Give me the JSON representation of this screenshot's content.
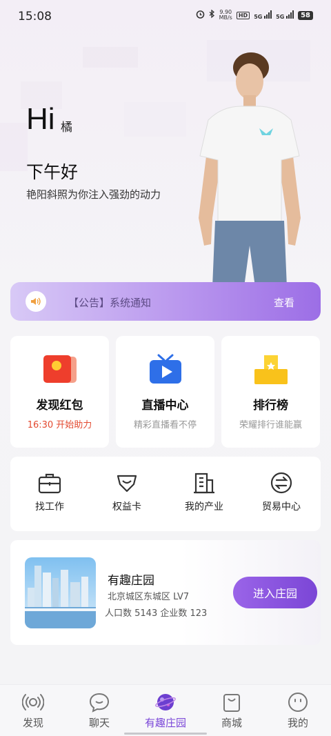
{
  "status_bar": {
    "time": "15:08",
    "network_speed": "9.90\nMB/s",
    "hd_label": "HD",
    "signal1": "5G",
    "signal2": "5G",
    "battery": "58"
  },
  "hero": {
    "hi": "Hi",
    "name": "橘",
    "greeting": "下午好",
    "subtitle": "艳阳斜照为你注入强劲的动力"
  },
  "notice": {
    "text": "【公告】系统通知",
    "action": "查看"
  },
  "features": [
    {
      "title": "发现红包",
      "subtitle": "16:30 开始助力",
      "icon": "red-envelope-icon",
      "subtitle_color": "#e3492f"
    },
    {
      "title": "直播中心",
      "subtitle": "精彩直播看不停",
      "icon": "live-tv-icon"
    },
    {
      "title": "排行榜",
      "subtitle": "荣耀排行谁能赢",
      "icon": "podium-icon"
    }
  ],
  "tools": [
    {
      "label": "找工作",
      "icon": "briefcase-icon"
    },
    {
      "label": "权益卡",
      "icon": "benefit-card-icon"
    },
    {
      "label": "我的产业",
      "icon": "building-icon"
    },
    {
      "label": "贸易中心",
      "icon": "exchange-icon"
    }
  ],
  "manor": {
    "title": "有趣庄园",
    "location": "北京城区东城区 LV7",
    "stats": "人口数 5143 企业数 123",
    "button": "进入庄园"
  },
  "bottom_nav": [
    {
      "label": "发现",
      "icon": "broadcast-icon",
      "active": false
    },
    {
      "label": "聊天",
      "icon": "chat-icon",
      "active": false
    },
    {
      "label": "有趣庄园",
      "icon": "planet-icon",
      "active": true
    },
    {
      "label": "商城",
      "icon": "shopping-bag-icon",
      "active": false
    },
    {
      "label": "我的",
      "icon": "smiley-icon",
      "active": false
    }
  ],
  "colors": {
    "accent": "#7a46d8",
    "notice_gradient_end": "#9c6ee6",
    "highlight_red": "#e3492f"
  }
}
